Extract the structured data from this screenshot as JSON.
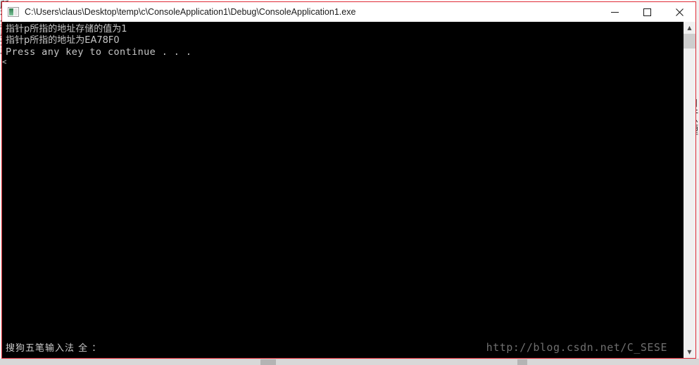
{
  "window": {
    "title": "C:\\Users\\claus\\Desktop\\temp\\c\\ConsoleApplication1\\Debug\\ConsoleApplication1.exe",
    "icon": "console-app-icon",
    "controls": {
      "minimize_label": "—",
      "maximize_label": "□",
      "close_label": "✕"
    },
    "border_color": "#e02b36",
    "titlebar_bg": "#ffffff",
    "client_bg": "#000000"
  },
  "console": {
    "lines": [
      "指针p所指的地址存储的值为1",
      "指针p所指的地址为EA78F0",
      "Press any key to continue . . ."
    ],
    "cursor_fragment": "<",
    "text_color": "#c8c8c8"
  },
  "ime": {
    "status_text": "搜狗五笔输入法 全 ："
  },
  "watermark": {
    "text": "http://blog.csdn.net/C_SESE",
    "color": "#6f6f6f"
  },
  "scrollbar": {
    "up_arrow": "▲",
    "down_arrow": "▼",
    "thumb_color": "#cdcdcd",
    "track_color": "#f0f0f0"
  },
  "desktop": {
    "left_edge_text": "所有集成开发",
    "right_edge_text": "月件处理",
    "right_edge_text2": "设置"
  }
}
